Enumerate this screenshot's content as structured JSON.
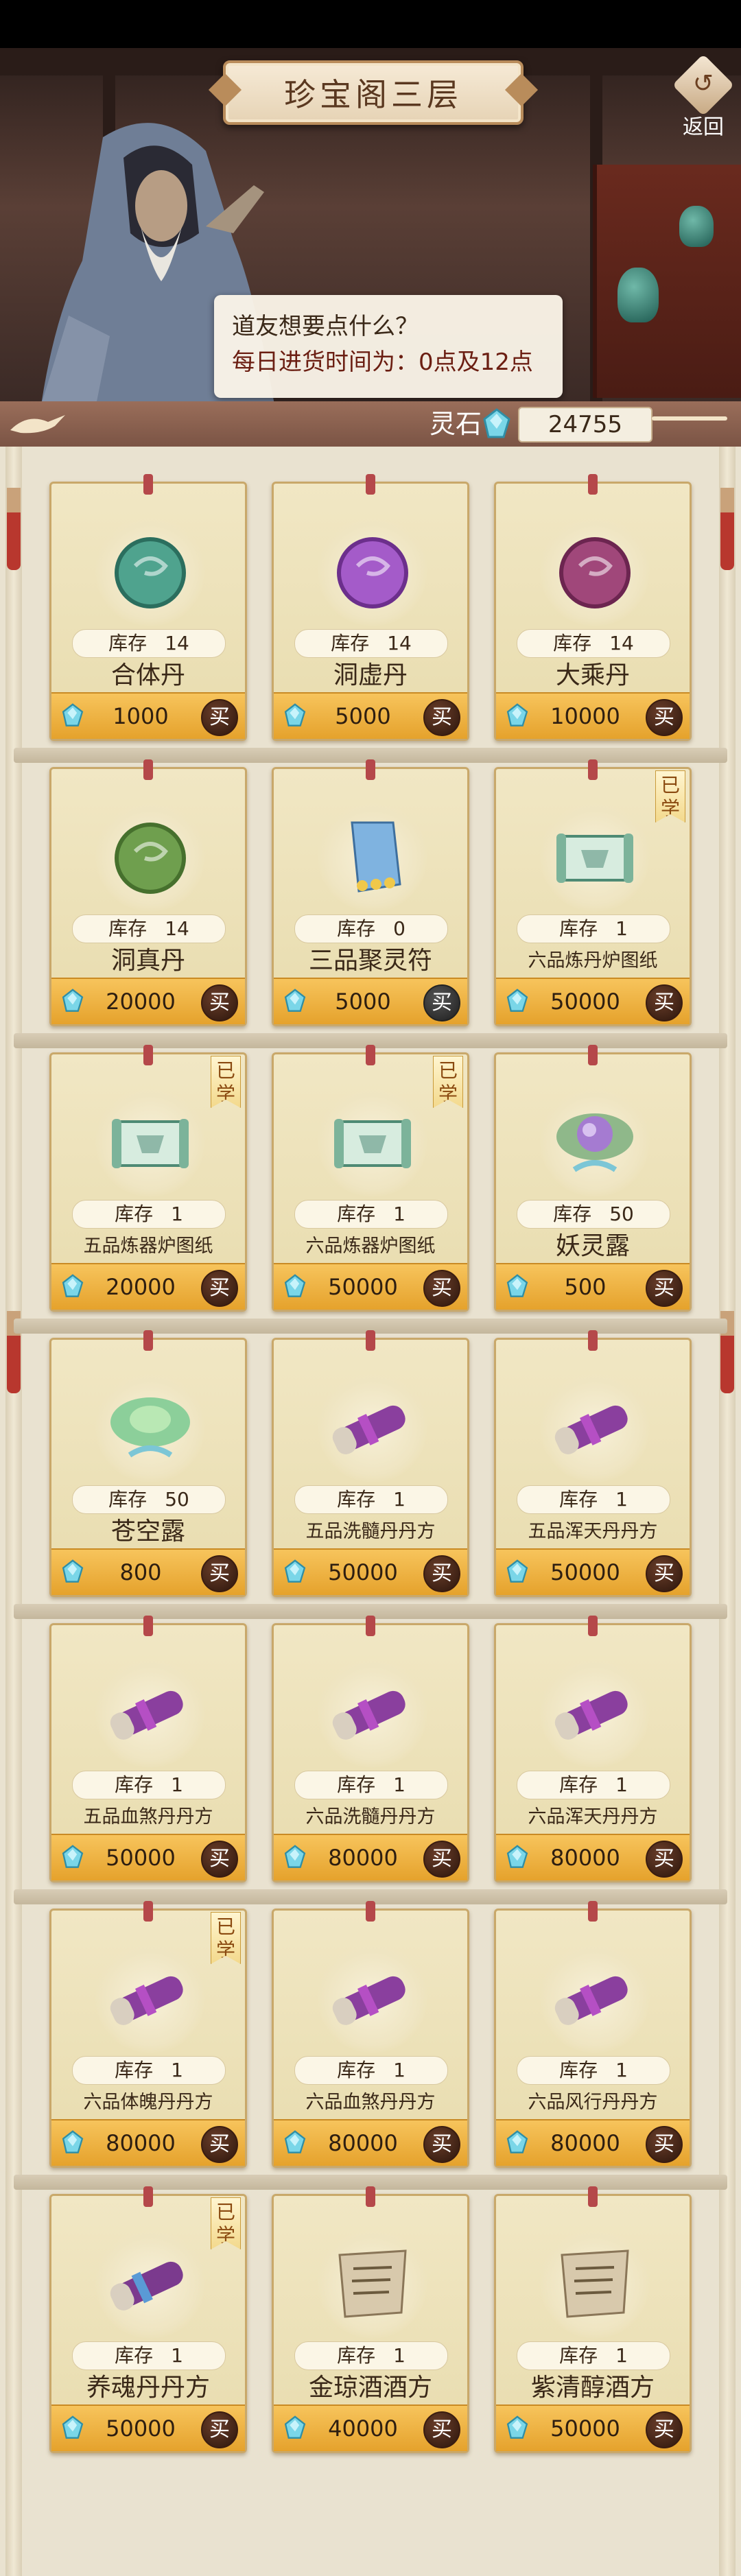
{
  "header": {
    "title": "珍宝阁三层",
    "back_label": "返回",
    "dialog_line1": "道友想要点什么？",
    "dialog_line2": "每日进货时间为：0点及12点"
  },
  "currency": {
    "label": "灵石",
    "value": "24755"
  },
  "labels": {
    "stock": "库存",
    "buy": "买",
    "learned": "已学"
  },
  "items": [
    {
      "name": "合体丹",
      "stock": "14",
      "price": "1000",
      "icon": "teal-pill-orb",
      "learned": false,
      "available": true
    },
    {
      "name": "洞虚丹",
      "stock": "14",
      "price": "5000",
      "icon": "purple-pill-orb",
      "learned": false,
      "available": true
    },
    {
      "name": "大乘丹",
      "stock": "14",
      "price": "10000",
      "icon": "magenta-pill-orb",
      "learned": false,
      "available": true
    },
    {
      "name": "洞真丹",
      "stock": "14",
      "price": "20000",
      "icon": "green-pill-orb",
      "learned": false,
      "available": true
    },
    {
      "name": "三品聚灵符",
      "stock": "0",
      "price": "5000",
      "icon": "talisman-scroll",
      "learned": false,
      "available": false
    },
    {
      "name": "六品炼丹炉图纸",
      "stock": "1",
      "price": "50000",
      "icon": "blueprint-scroll",
      "learned": true,
      "available": true
    },
    {
      "name": "五品炼器炉图纸",
      "stock": "1",
      "price": "20000",
      "icon": "blueprint-scroll",
      "learned": true,
      "available": true
    },
    {
      "name": "六品炼器炉图纸",
      "stock": "1",
      "price": "50000",
      "icon": "blueprint-scroll",
      "learned": true,
      "available": true
    },
    {
      "name": "妖灵露",
      "stock": "50",
      "price": "500",
      "icon": "purple-lotus",
      "learned": false,
      "available": true
    },
    {
      "name": "苍空露",
      "stock": "50",
      "price": "800",
      "icon": "green-lotus",
      "learned": false,
      "available": true
    },
    {
      "name": "五品洗髓丹丹方",
      "stock": "1",
      "price": "50000",
      "icon": "recipe-scroll",
      "learned": false,
      "available": true
    },
    {
      "name": "五品浑天丹丹方",
      "stock": "1",
      "price": "50000",
      "icon": "recipe-scroll",
      "learned": false,
      "available": true
    },
    {
      "name": "五品血煞丹丹方",
      "stock": "1",
      "price": "50000",
      "icon": "recipe-scroll",
      "learned": false,
      "available": true
    },
    {
      "name": "六品洗髓丹丹方",
      "stock": "1",
      "price": "80000",
      "icon": "recipe-scroll",
      "learned": false,
      "available": true
    },
    {
      "name": "六品浑天丹丹方",
      "stock": "1",
      "price": "80000",
      "icon": "recipe-scroll",
      "learned": false,
      "available": true
    },
    {
      "name": "六品体魄丹丹方",
      "stock": "1",
      "price": "80000",
      "icon": "recipe-scroll",
      "learned": true,
      "available": true
    },
    {
      "name": "六品血煞丹丹方",
      "stock": "1",
      "price": "80000",
      "icon": "recipe-scroll",
      "learned": false,
      "available": true
    },
    {
      "name": "六品风行丹丹方",
      "stock": "1",
      "price": "80000",
      "icon": "recipe-scroll",
      "learned": false,
      "available": true
    },
    {
      "name": "养魂丹丹方",
      "stock": "1",
      "price": "50000",
      "icon": "recipe-scroll-blue",
      "learned": true,
      "available": true
    },
    {
      "name": "金琼酒酒方",
      "stock": "1",
      "price": "40000",
      "icon": "paper-recipe",
      "learned": false,
      "available": true
    },
    {
      "name": "紫清醇酒方",
      "stock": "1",
      "price": "50000",
      "icon": "paper-recipe",
      "learned": false,
      "available": true
    }
  ],
  "colors": {
    "card_bg": "#f1e7c4",
    "buy_bar": "#f5b845",
    "dialog_accent": "#6b1e12"
  }
}
